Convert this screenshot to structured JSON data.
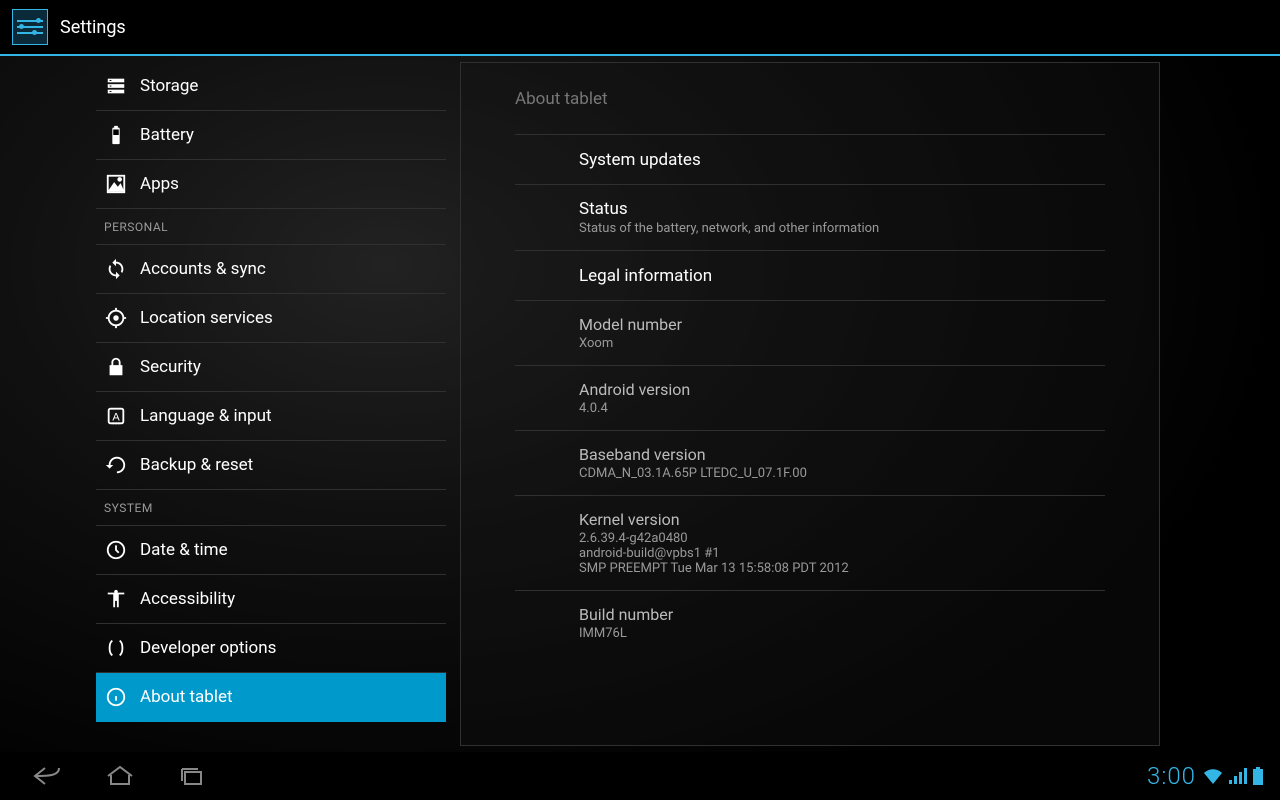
{
  "header": {
    "title": "Settings"
  },
  "sidebar": {
    "items": [
      {
        "label": "Storage",
        "icon": "storage-icon"
      },
      {
        "label": "Battery",
        "icon": "battery-icon"
      },
      {
        "label": "Apps",
        "icon": "apps-icon"
      }
    ],
    "personal_header": "PERSONAL",
    "personal_items": [
      {
        "label": "Accounts & sync",
        "icon": "sync-icon"
      },
      {
        "label": "Location services",
        "icon": "location-icon"
      },
      {
        "label": "Security",
        "icon": "security-icon"
      },
      {
        "label": "Language & input",
        "icon": "language-icon"
      },
      {
        "label": "Backup & reset",
        "icon": "backup-icon"
      }
    ],
    "system_header": "SYSTEM",
    "system_items": [
      {
        "label": "Date & time",
        "icon": "datetime-icon"
      },
      {
        "label": "Accessibility",
        "icon": "accessibility-icon"
      },
      {
        "label": "Developer options",
        "icon": "developer-icon"
      },
      {
        "label": "About tablet",
        "icon": "about-icon"
      }
    ]
  },
  "detail": {
    "title": "About tablet",
    "system_updates": "System updates",
    "status_title": "Status",
    "status_sub": "Status of the battery, network, and other information",
    "legal": "Legal information",
    "model_title": "Model number",
    "model_value": "Xoom",
    "android_title": "Android version",
    "android_value": "4.0.4",
    "baseband_title": "Baseband version",
    "baseband_value": "CDMA_N_03.1A.65P LTEDC_U_07.1F.00",
    "kernel_title": "Kernel version",
    "kernel_value": "2.6.39.4-g42a0480\nandroid-build@vpbs1 #1\nSMP PREEMPT Tue Mar 13 15:58:08 PDT 2012",
    "build_title": "Build number",
    "build_value": "IMM76L"
  },
  "status_bar": {
    "time": "3:00"
  }
}
